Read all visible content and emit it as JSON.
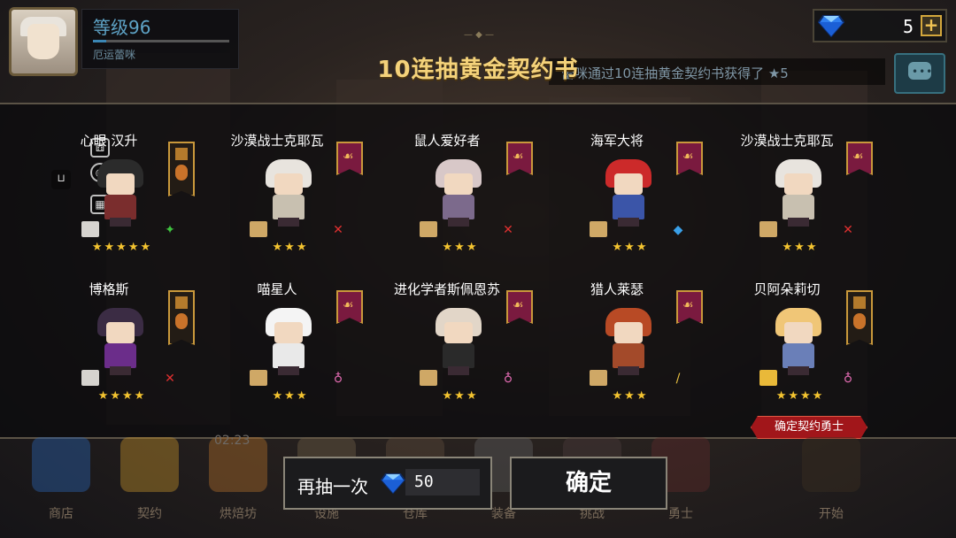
{
  "header": {
    "level": "等级96",
    "level_progress": 0.1,
    "player_name": "厄运蕾咪",
    "gems": "5",
    "gem_add": "+",
    "ticker": "蕾咪通过10连抽黄金契约书获得了 ★5"
  },
  "title": "10连抽黄金契约书",
  "cards": [
    {
      "name": "心眼 汉升",
      "stars": "★★★★★",
      "class_icon": "shuriken-icon",
      "scroll": "white",
      "banner": "tall"
    },
    {
      "name": "沙漠战士克耶瓦",
      "stars": "★★★",
      "class_icon": "sword-icon",
      "scroll": "tan",
      "banner": "crest"
    },
    {
      "name": "鼠人爱好者",
      "stars": "★★★",
      "class_icon": "sword-icon",
      "scroll": "tan",
      "banner": "crest"
    },
    {
      "name": "海军大将",
      "stars": "★★★",
      "class_icon": "water-icon",
      "scroll": "tan",
      "banner": "crest"
    },
    {
      "name": "沙漠战士克耶瓦",
      "stars": "★★★",
      "class_icon": "sword-icon",
      "scroll": "tan",
      "banner": "crest"
    },
    {
      "name": "博格斯",
      "stars": "★★★★",
      "class_icon": "sword-icon",
      "scroll": "white",
      "banner": "tall"
    },
    {
      "name": "喵星人",
      "stars": "★★★",
      "class_icon": "potion-icon",
      "scroll": "tan",
      "banner": "crest"
    },
    {
      "name": "进化学者斯佩恩苏",
      "stars": "★★★",
      "class_icon": "potion-icon",
      "scroll": "tan",
      "banner": "crest"
    },
    {
      "name": "猎人莱瑟",
      "stars": "★★★",
      "class_icon": "staff-icon",
      "scroll": "tan",
      "banner": "crest"
    },
    {
      "name": "贝阿朵莉切",
      "stars": "★★★★",
      "class_icon": "potion-icon",
      "scroll": "gold",
      "banner": "tall"
    }
  ],
  "confirm_tag": "确定契约勇士",
  "bottom_nav": {
    "timer": "02:23",
    "items": [
      "商店",
      "契约",
      "烘焙坊",
      "设施",
      "仓库",
      "装备",
      "挑战",
      "勇士",
      "开始"
    ]
  },
  "buttons": {
    "redraw_label": "再抽一次",
    "redraw_cost": "50",
    "ok_label": "确定"
  },
  "colors": {
    "title": "#f4d27a",
    "stars": "#f4c430",
    "accent_banner": "#7a1a3f",
    "tag": "#a1161a"
  }
}
